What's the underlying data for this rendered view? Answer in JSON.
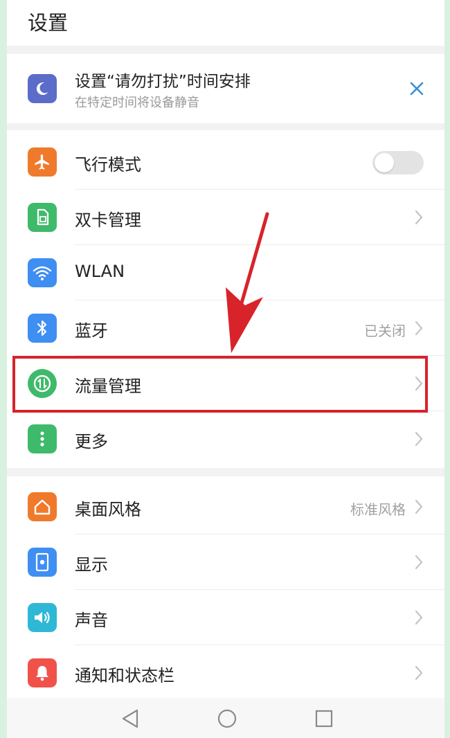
{
  "header": {
    "title": "设置"
  },
  "dnd_card": {
    "title": "设置“请勿打扰”时间安排",
    "subtitle": "在特定时间将设备静音",
    "icon": "moon-icon",
    "icon_color": "#5b6cc9"
  },
  "group1": {
    "items": [
      {
        "label": "飞行模式",
        "icon": "airplane-icon",
        "color": "#f07a2c",
        "control": "toggle",
        "toggle_on": false
      },
      {
        "label": "双卡管理",
        "icon": "sim-card-icon",
        "color": "#3fba6a",
        "control": "chevron"
      },
      {
        "label": "WLAN",
        "icon": "wifi-icon",
        "color": "#3f8ef2",
        "control": "chevron"
      },
      {
        "label": "蓝牙",
        "icon": "bluetooth-icon",
        "color": "#3f8ef2",
        "control": "chevron",
        "value": "已关闭"
      },
      {
        "label": "流量管理",
        "icon": "data-usage-icon",
        "color": "#3fba6a",
        "control": "chevron"
      },
      {
        "label": "更多",
        "icon": "more-icon",
        "color": "#3fba6a",
        "control": "chevron"
      }
    ]
  },
  "group2": {
    "items": [
      {
        "label": "桌面风格",
        "icon": "home-icon",
        "color": "#f07a2c",
        "control": "chevron",
        "value": "标准风格"
      },
      {
        "label": "显示",
        "icon": "display-icon",
        "color": "#3f8ef2",
        "control": "chevron"
      },
      {
        "label": "声音",
        "icon": "speaker-icon",
        "color": "#2fb8d6",
        "control": "chevron"
      },
      {
        "label": "通知和状态栏",
        "icon": "bell-icon",
        "color": "#f0524a",
        "control": "chevron"
      }
    ]
  },
  "nav": {
    "back": "back-icon",
    "home": "home-circle-icon",
    "recents": "recents-icon"
  },
  "annotation": {
    "highlight_color": "#d8232a",
    "highlighted_item": "流量管理"
  }
}
